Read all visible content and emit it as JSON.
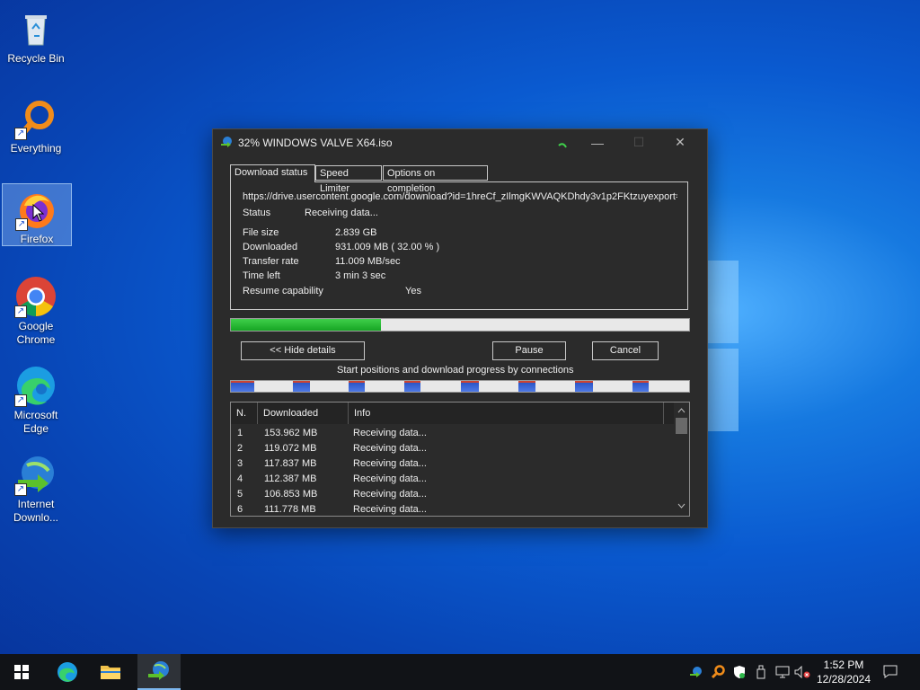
{
  "desktop": {
    "icons": [
      {
        "label": "Recycle Bin"
      },
      {
        "label": "Everything"
      },
      {
        "label": "Firefox"
      },
      {
        "label_line1": "Google",
        "label_line2": "Chrome"
      },
      {
        "label_line1": "Microsoft",
        "label_line2": "Edge"
      },
      {
        "label_line1": "Internet",
        "label_line2": "Downlo..."
      }
    ]
  },
  "idm": {
    "title": "32% WINDOWS VALVE X64.iso",
    "tabs": [
      "Download status",
      "Speed Limiter",
      "Options on completion"
    ],
    "url": "https://drive.usercontent.google.com/download?id=1hreCf_zIlmgKWVAQKDhdy3v1p2FKtzuyexport=",
    "status_label": "Status",
    "status_value": "Receiving data...",
    "file_size_label": "File size",
    "file_size_value": "2.839  GB",
    "downloaded_label": "Downloaded",
    "downloaded_value": "931.009  MB  ( 32.00 % )",
    "transfer_rate_label": "Transfer rate",
    "transfer_rate_value": "11.009  MB/sec",
    "time_left_label": "Time left",
    "time_left_value": "3 min 3 sec",
    "resume_label": "Resume capability",
    "resume_value": "Yes",
    "progress_fraction": 0.32,
    "buttons": {
      "hide_details": "<< Hide details",
      "pause": "Pause",
      "cancel": "Cancel"
    },
    "connections_caption": "Start positions and download progress by connections",
    "table": {
      "columns": [
        "N.",
        "Downloaded",
        "Info"
      ],
      "rows": [
        {
          "n": "1",
          "downloaded": "153.962  MB",
          "info": "Receiving data..."
        },
        {
          "n": "2",
          "downloaded": "119.072  MB",
          "info": "Receiving data..."
        },
        {
          "n": "3",
          "downloaded": "117.837  MB",
          "info": "Receiving data..."
        },
        {
          "n": "4",
          "downloaded": "112.387  MB",
          "info": "Receiving data..."
        },
        {
          "n": "5",
          "downloaded": "106.853  MB",
          "info": "Receiving data..."
        },
        {
          "n": "6",
          "downloaded": "111.778  MB",
          "info": "Receiving data..."
        }
      ]
    }
  },
  "taskbar": {
    "time": "1:52 PM",
    "date": "12/28/2024"
  },
  "colors": {
    "progress": "#16a524",
    "segment": "#2b56c8",
    "taskbar": "#111317"
  }
}
